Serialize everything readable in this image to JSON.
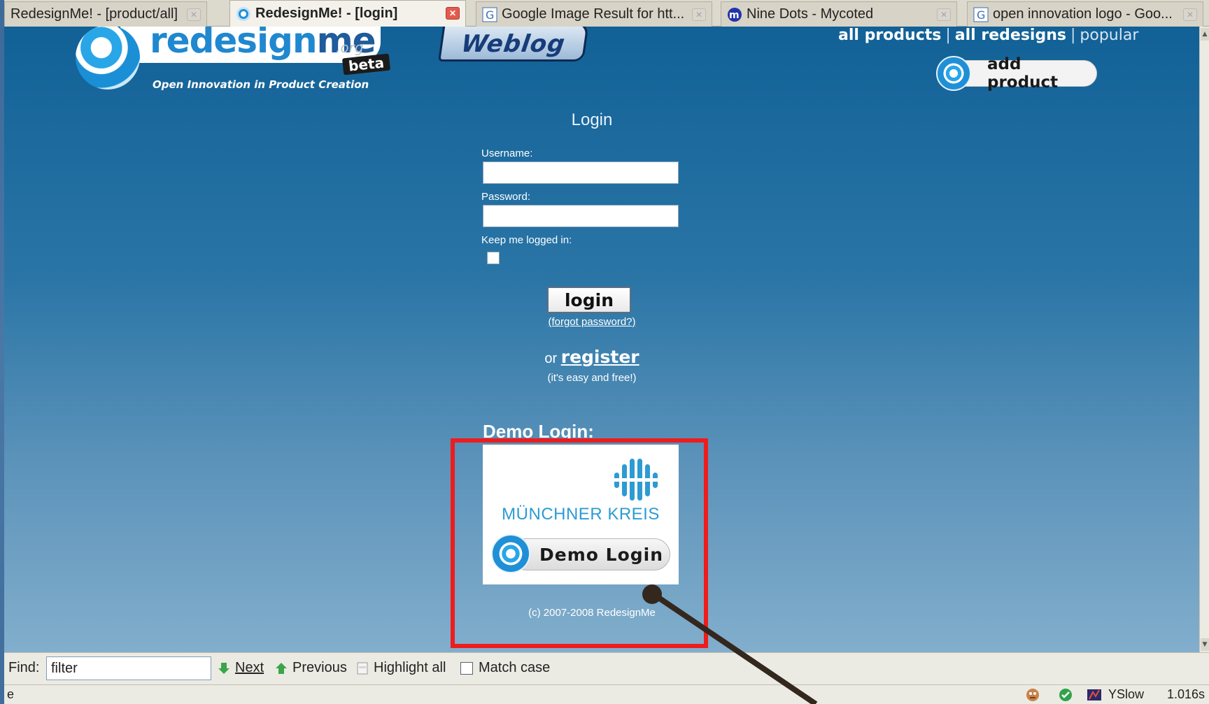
{
  "tabs": [
    {
      "title": "RedesignMe! - [product/all]",
      "icon": "generic-icon",
      "active": false
    },
    {
      "title": "RedesignMe! - [login]",
      "icon": "redesignme-icon",
      "active": true
    },
    {
      "title": "Google Image Result for htt...",
      "icon": "google-icon",
      "active": false
    },
    {
      "title": "Nine Dots - Mycoted",
      "icon": "mycoted-icon",
      "active": false
    },
    {
      "title": "open innovation logo - Goo...",
      "icon": "google-icon",
      "active": false
    }
  ],
  "header": {
    "logo_text_main": "redesign",
    "logo_text_me": "me",
    "logo_org": ".org",
    "logo_beta": "beta",
    "logo_tagline": "Open Innovation in Product Creation",
    "weblog_label": "Weblog",
    "nav": {
      "all_products": "all products",
      "separator": "|",
      "all_redesigns": "all redesigns",
      "popular": "popular"
    },
    "add_product_label": "add product"
  },
  "login": {
    "title": "Login",
    "username_label": "Username:",
    "username_value": "",
    "password_label": "Password:",
    "password_value": "",
    "remember_label": "Keep me logged in:",
    "remember_checked": false,
    "login_button": "login",
    "forgot_link": "(forgot password?)",
    "or_text": "or",
    "register_link": "register",
    "register_sub": "(it's easy and free!)"
  },
  "demo": {
    "heading": "Demo Login:",
    "sponsor_name": "MÜNCHNER KREIS",
    "button_label": "Demo Login"
  },
  "footer": {
    "copyright": "(c) 2007-2008 RedesignMe"
  },
  "findbar": {
    "label": "Find:",
    "query": "filter",
    "next": "Next",
    "previous": "Previous",
    "highlight_all": "Highlight all",
    "match_case": "Match case"
  },
  "statusbar": {
    "left_text": "e",
    "yslow_label": "YSlow",
    "load_time": "1.016s"
  },
  "colors": {
    "highlight": "#ee1c1c",
    "page_top": "#116197",
    "page_bottom": "#82aecc",
    "brand_blue": "#1f88cf"
  }
}
